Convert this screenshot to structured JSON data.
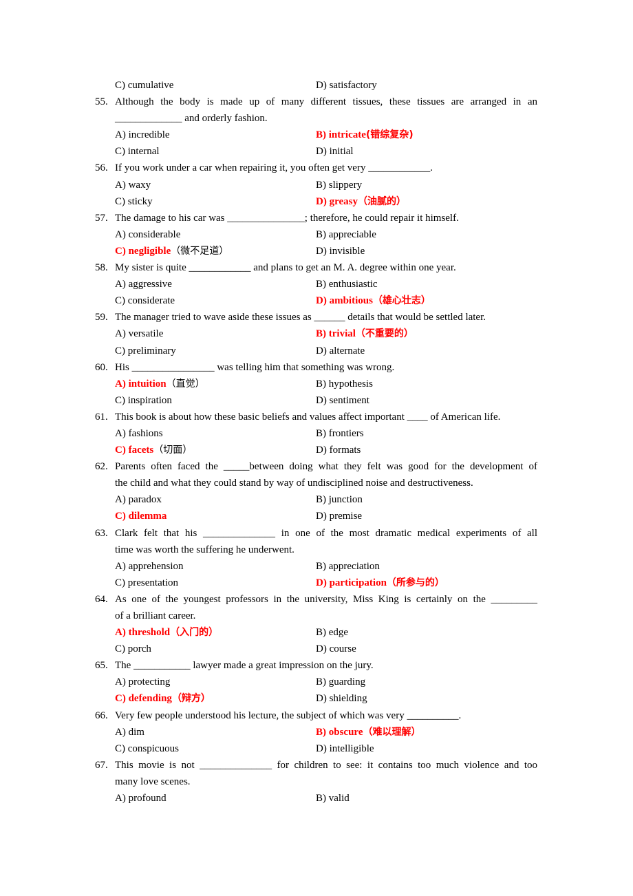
{
  "document": {
    "accent_color": "#ff0000",
    "lines": [
      {
        "type": "options",
        "a": {
          "label": "C) cumulative"
        },
        "b": {
          "label": "D) satisfactory"
        }
      },
      {
        "type": "stem",
        "num": "55.",
        "text": "Although the body is made up of many different tissues, these tissues are arranged in an",
        "justify": true
      },
      {
        "type": "cont",
        "text": "_____________ and orderly fashion."
      },
      {
        "type": "options",
        "a": {
          "label": "A) incredible"
        },
        "b": {
          "label": "B) intricate",
          "answer": true,
          "gloss": "(错综复杂)",
          "gloss_red": true
        }
      },
      {
        "type": "options",
        "a": {
          "label": "C) internal"
        },
        "b": {
          "label": "D) initial"
        }
      },
      {
        "type": "stem",
        "num": "56.",
        "text": "If you work under a car when repairing it, you often get very ____________."
      },
      {
        "type": "options",
        "a": {
          "label": "A) waxy"
        },
        "b": {
          "label": "B) slippery"
        }
      },
      {
        "type": "options",
        "a": {
          "label": "C) sticky"
        },
        "b": {
          "label": "D) greasy",
          "answer": true,
          "gloss": "（油腻的）",
          "gloss_red": true
        }
      },
      {
        "type": "stem",
        "num": "57.",
        "text": "The damage to his car was _______________; therefore, he could repair it himself."
      },
      {
        "type": "options",
        "a": {
          "label": "A) considerable"
        },
        "b": {
          "label": "B) appreciable"
        }
      },
      {
        "type": "options",
        "a": {
          "label": "C) negligible",
          "answer": true,
          "gloss": "（微不足道）",
          "gloss_red": false
        },
        "b": {
          "label": "D) invisible"
        }
      },
      {
        "type": "stem",
        "num": "58.",
        "text": "My sister is quite ____________ and plans to get an M. A. degree within one year."
      },
      {
        "type": "options",
        "a": {
          "label": "A) aggressive"
        },
        "b": {
          "label": "B) enthusiastic"
        }
      },
      {
        "type": "options",
        "a": {
          "label": "C) considerate"
        },
        "b": {
          "label": "D) ambitious",
          "answer": true,
          "gloss": "（雄心壮志）",
          "gloss_red": true
        }
      },
      {
        "type": "stem",
        "num": "59.",
        "text": "The manager tried to wave aside these issues as ______ details that would be settled later."
      },
      {
        "type": "options",
        "a": {
          "label": "A) versatile"
        },
        "b": {
          "label": "B) trivial",
          "answer": true,
          "gloss": "（不重要的）",
          "gloss_red": true
        }
      },
      {
        "type": "options",
        "a": {
          "label": "C) preliminary"
        },
        "b": {
          "label": "D) alternate"
        }
      },
      {
        "type": "stem",
        "num": "60.",
        "text": "His ________________ was telling him that something was wrong."
      },
      {
        "type": "options",
        "a": {
          "label": "A) intuition",
          "answer": true,
          "gloss": "（直觉）",
          "gloss_red": false
        },
        "b": {
          "label": "B) hypothesis"
        }
      },
      {
        "type": "options",
        "a": {
          "label": "C) inspiration"
        },
        "b": {
          "label": "D) sentiment"
        }
      },
      {
        "type": "stem",
        "num": "61.",
        "text": "This book is about how these basic beliefs and values affect important ____ of American life."
      },
      {
        "type": "options",
        "a": {
          "label": "A) fashions"
        },
        "b": {
          "label": "B) frontiers"
        }
      },
      {
        "type": "options",
        "a": {
          "label": "C) facets",
          "answer": true,
          "gloss": "（切面）",
          "gloss_red": false
        },
        "b": {
          "label": "D) formats"
        }
      },
      {
        "type": "stem",
        "num": "62.",
        "text": "Parents often faced the _____between doing what they felt was good for the development of",
        "justify": true
      },
      {
        "type": "cont",
        "text": "the child and what they could stand by way of undisciplined noise and destructiveness."
      },
      {
        "type": "options",
        "a": {
          "label": "A) paradox"
        },
        "b": {
          "label": "B) junction"
        }
      },
      {
        "type": "options",
        "a": {
          "label": "C) dilemma",
          "answer": true
        },
        "b": {
          "label": "D) premise"
        }
      },
      {
        "type": "stem",
        "num": "63.",
        "text": "Clark felt that his ______________ in one of the most dramatic medical experiments of all",
        "justify": true
      },
      {
        "type": "cont",
        "text": "time was worth the suffering he underwent."
      },
      {
        "type": "options",
        "a": {
          "label": "A) apprehension"
        },
        "b": {
          "label": "B) appreciation"
        }
      },
      {
        "type": "options",
        "a": {
          "label": "C) presentation"
        },
        "b": {
          "label": "D) participation",
          "answer": true,
          "gloss": "（所参与的）",
          "gloss_red": true
        }
      },
      {
        "type": "stem",
        "num": "64.",
        "text": "As one of the youngest professors in the university, Miss King is certainly on the _________",
        "justify": true
      },
      {
        "type": "cont",
        "text": "of a brilliant career."
      },
      {
        "type": "options",
        "a": {
          "label": "A) threshold",
          "answer": true,
          "gloss": "（入门的）",
          "gloss_red": true
        },
        "b": {
          "label": "B) edge"
        }
      },
      {
        "type": "options",
        "a": {
          "label": "C) porch"
        },
        "b": {
          "label": "D) course"
        }
      },
      {
        "type": "stem",
        "num": "65.",
        "text": "The ___________ lawyer made a great impression on the jury."
      },
      {
        "type": "options",
        "a": {
          "label": "A) protecting"
        },
        "b": {
          "label": "B) guarding"
        }
      },
      {
        "type": "options",
        "a": {
          "label": "C) defending",
          "answer": true,
          "gloss": "（辩方）",
          "gloss_red": true
        },
        "b": {
          "label": "D) shielding"
        }
      },
      {
        "type": "stem",
        "num": "66.",
        "text": "Very few people understood his lecture, the subject of which was very __________."
      },
      {
        "type": "options",
        "a": {
          "label": "A) dim"
        },
        "b": {
          "label": "B) obscure",
          "answer": true,
          "gloss": "（难以理解）",
          "gloss_red": true
        }
      },
      {
        "type": "options",
        "a": {
          "label": "C) conspicuous"
        },
        "b": {
          "label": "D) intelligible"
        }
      },
      {
        "type": "stem",
        "num": "67.",
        "text": "This movie is not ______________ for children to see: it contains too much violence and too",
        "justify": true
      },
      {
        "type": "cont",
        "text": "many love scenes."
      },
      {
        "type": "options",
        "a": {
          "label": "A) profound"
        },
        "b": {
          "label": "B) valid"
        }
      }
    ]
  }
}
